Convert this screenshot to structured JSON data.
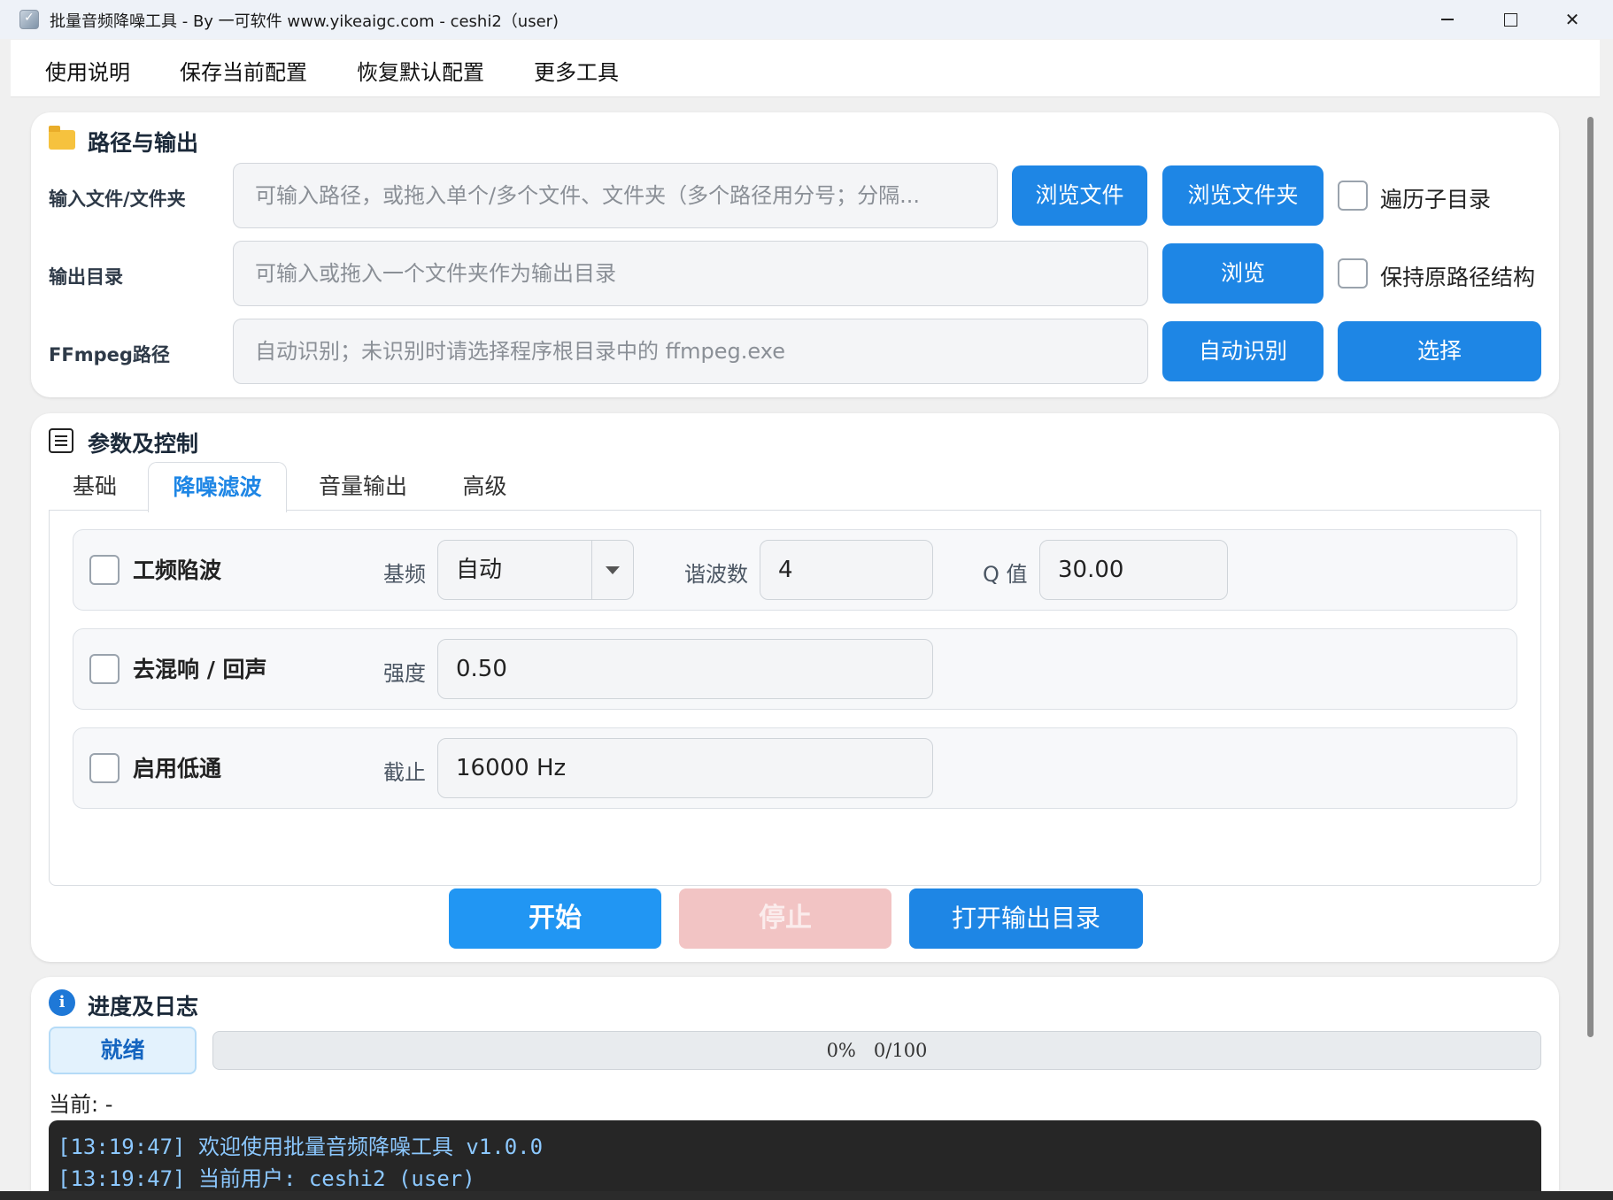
{
  "window": {
    "title": "批量音频降噪工具 - By 一可软件 www.yikeaigc.com - ceshi2（user)"
  },
  "menu": {
    "items": [
      "使用说明",
      "保存当前配置",
      "恢复默认配置",
      "更多工具"
    ]
  },
  "path_panel": {
    "title": "路径与输出",
    "input_label": "输入文件/文件夹",
    "input_placeholder": "可输入路径，或拖入单个/多个文件、文件夹（多个路径用分号；分隔...",
    "browse_file": "浏览文件",
    "browse_folder": "浏览文件夹",
    "recurse_label": "遍历子目录",
    "output_label": "输出目录",
    "output_placeholder": "可输入或拖入一个文件夹作为输出目录",
    "browse": "浏览",
    "keep_structure_label": "保持原路径结构",
    "ffmpeg_label": "FFmpeg路径",
    "ffmpeg_placeholder": "自动识别；未识别时请选择程序根目录中的 ffmpeg.exe",
    "auto_detect": "自动识别",
    "select": "选择"
  },
  "params_panel": {
    "title": "参数及控制",
    "tabs": [
      "基础",
      "降噪滤波",
      "音量输出",
      "高级"
    ],
    "active_tab": "降噪滤波",
    "notch": {
      "title": "工频陷波",
      "base_label": "基频",
      "base_value": "自动",
      "harmonics_label": "谐波数",
      "harmonics_value": "4",
      "q_label": "Q 值",
      "q_value": "30.00"
    },
    "dereverb": {
      "title": "去混响 / 回声",
      "strength_label": "强度",
      "strength_value": "0.50"
    },
    "lowpass": {
      "title": "启用低通",
      "cutoff_label": "截止",
      "cutoff_value": "16000 Hz"
    },
    "start": "开始",
    "stop": "停止",
    "open_output": "打开输出目录"
  },
  "progress_panel": {
    "title": "进度及日志",
    "status": "就绪",
    "progress_text": "0%   0/100",
    "progress_fraction": 0,
    "current": "当前: -",
    "log": [
      "[13:19:47] 欢迎使用批量音频降噪工具 v1.0.0",
      "[13:19:47] 当前用户: ceshi2 (user)"
    ]
  },
  "colors": {
    "accent": "#1e86e5",
    "stop_disabled": "#f2c4c4",
    "status_text": "#1565c0"
  }
}
